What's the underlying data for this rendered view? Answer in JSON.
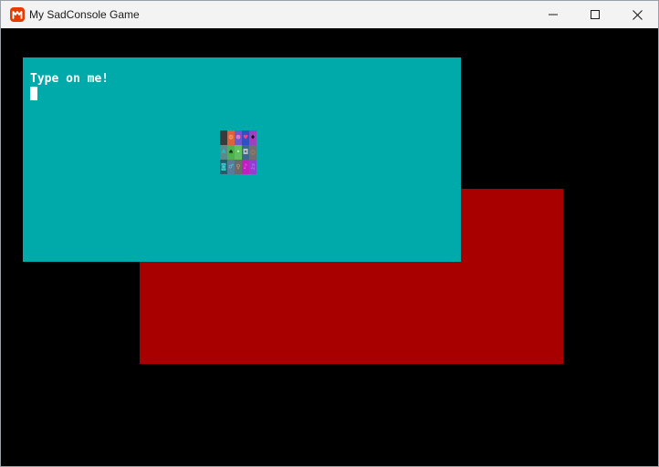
{
  "window": {
    "title": "My SadConsole Game",
    "icon": "monogame-icon",
    "controls": {
      "minimize": "minimize-icon",
      "maximize": "maximize-icon",
      "close": "close-icon"
    }
  },
  "colors": {
    "background": "#000000",
    "teal_panel": "#00aaaa",
    "red_panel": "#a80000",
    "text": "#ffffff"
  },
  "console": {
    "prompt_text": "Type on me!"
  },
  "glyph_grid": {
    "cells": [
      {
        "bg": "#3a3a3a",
        "fg": "#3a3a3a",
        "ch": " "
      },
      {
        "bg": "#e0603a",
        "fg": "#ffd080",
        "ch": "☺"
      },
      {
        "bg": "#6a5acd",
        "fg": "#ff80c0",
        "ch": "☻"
      },
      {
        "bg": "#3050c0",
        "fg": "#ff4080",
        "ch": "♥"
      },
      {
        "bg": "#a040c0",
        "fg": "#101010",
        "ch": "♦"
      },
      {
        "bg": "#5a8a8a",
        "fg": "#20c0c0",
        "ch": "♣"
      },
      {
        "bg": "#50b050",
        "fg": "#103010",
        "ch": "♠"
      },
      {
        "bg": "#60c060",
        "fg": "#a0ffa0",
        "ch": "•"
      },
      {
        "bg": "#3a6a8a",
        "fg": "#c0c0c0",
        "ch": "◘"
      },
      {
        "bg": "#707070",
        "fg": "#e08040",
        "ch": "○"
      },
      {
        "bg": "#2a5a6a",
        "fg": "#30d0d0",
        "ch": "◙"
      },
      {
        "bg": "#5a7a9a",
        "fg": "#40e0e0",
        "ch": "♂"
      },
      {
        "bg": "#6a6a6a",
        "fg": "#e0a060",
        "ch": "♀"
      },
      {
        "bg": "#c020c0",
        "fg": "#ff60ff",
        "ch": "♪"
      },
      {
        "bg": "#9040d0",
        "fg": "#c080ff",
        "ch": "♫"
      }
    ]
  }
}
